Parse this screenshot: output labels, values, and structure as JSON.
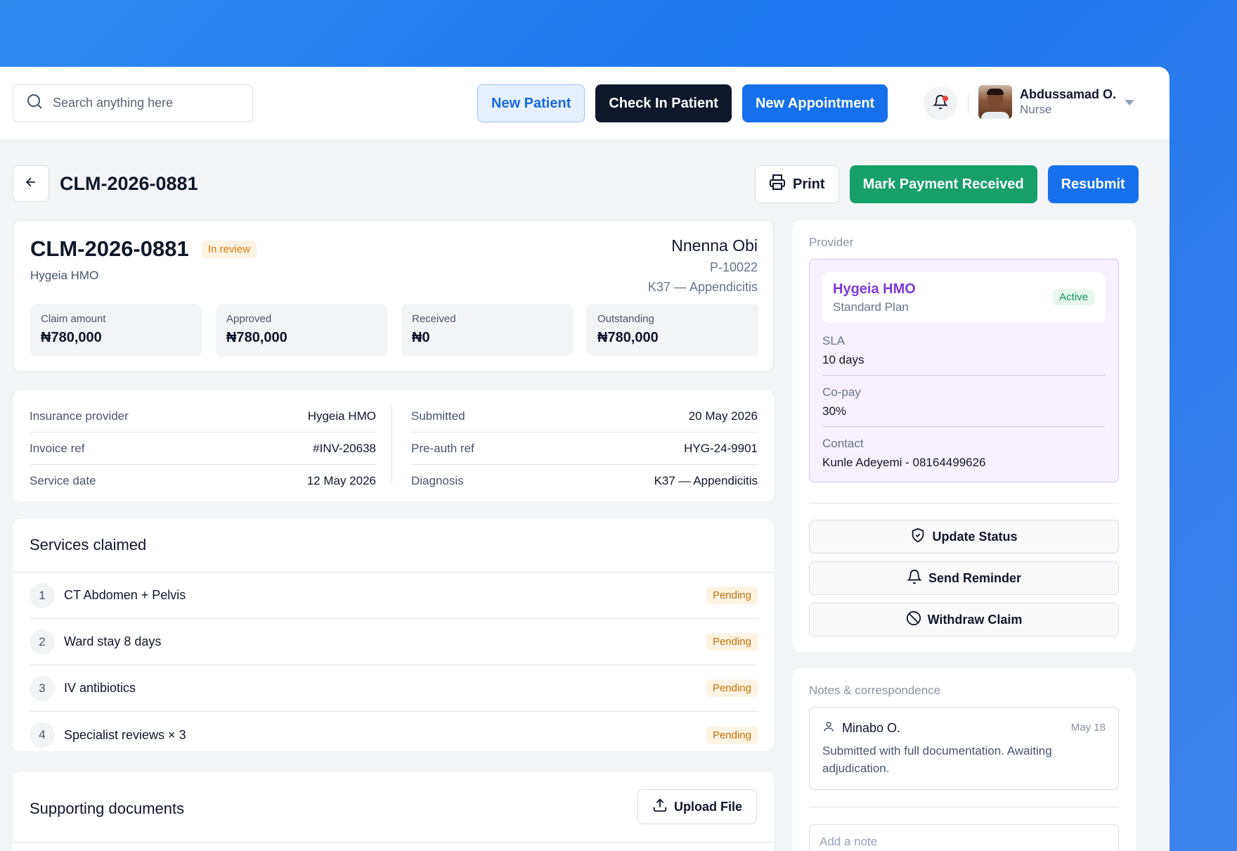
{
  "topbar": {
    "search_placeholder": "Search anything here",
    "new_patient": "New Patient",
    "check_in": "Check In Patient",
    "new_appointment": "New Appointment",
    "user": {
      "name": "Abdussamad O.",
      "role": "Nurse"
    }
  },
  "page": {
    "title": "CLM-2026-0881",
    "print": "Print",
    "mark_paid": "Mark Payment Received",
    "resubmit": "Resubmit"
  },
  "summary": {
    "claim_id": "CLM-2026-0881",
    "status": "In review",
    "hmo": "Hygeia HMO",
    "patient_name": "Nnenna Obi",
    "patient_id": "P-10022",
    "diagnosis": "K37 — Appendicitis",
    "amounts": [
      {
        "label": "Claim amount",
        "value": "₦780,000"
      },
      {
        "label": "Approved",
        "value": "₦780,000"
      },
      {
        "label": "Received",
        "value": "₦0"
      },
      {
        "label": "Outstanding",
        "value": "₦780,000"
      }
    ]
  },
  "details": {
    "left": [
      {
        "key": "Insurance provider",
        "value": "Hygeia HMO"
      },
      {
        "key": "Invoice ref",
        "value": "#INV-20638"
      },
      {
        "key": "Service date",
        "value": "12 May 2026"
      }
    ],
    "right": [
      {
        "key": "Submitted",
        "value": "20 May 2026"
      },
      {
        "key": "Pre-auth ref",
        "value": "HYG-24-9901"
      },
      {
        "key": "Diagnosis",
        "value": "K37 — Appendicitis"
      }
    ]
  },
  "services": {
    "title": "Services claimed",
    "items": [
      {
        "num": "1",
        "name": "CT Abdomen + Pelvis",
        "status": "Pending"
      },
      {
        "num": "2",
        "name": "Ward stay 8 days",
        "status": "Pending"
      },
      {
        "num": "3",
        "name": "IV antibiotics",
        "status": "Pending"
      },
      {
        "num": "4",
        "name": "Specialist reviews × 3",
        "status": "Pending"
      }
    ]
  },
  "documents": {
    "title": "Supporting documents",
    "upload": "Upload File"
  },
  "provider": {
    "section": "Provider",
    "name": "Hygeia HMO",
    "plan": "Standard Plan",
    "status": "Active",
    "sla_label": "SLA",
    "sla_value": "10 days",
    "copay_label": "Co-pay",
    "copay_value": "30%",
    "contact_label": "Contact",
    "contact_value": "Kunle Adeyemi - 08164499626",
    "update_status": "Update Status",
    "send_reminder": "Send Reminder",
    "withdraw": "Withdraw Claim"
  },
  "notes": {
    "section": "Notes & correspondence",
    "author": "Minabo O.",
    "date": "May 18",
    "text": "Submitted with full documentation. Awaiting adjudication.",
    "input_placeholder": "Add a note"
  },
  "colors": {
    "primary": "#1670ec",
    "success": "#17a06a",
    "dark": "#0f172a",
    "warning": "#d97706",
    "purple": "#7e3ad9"
  }
}
